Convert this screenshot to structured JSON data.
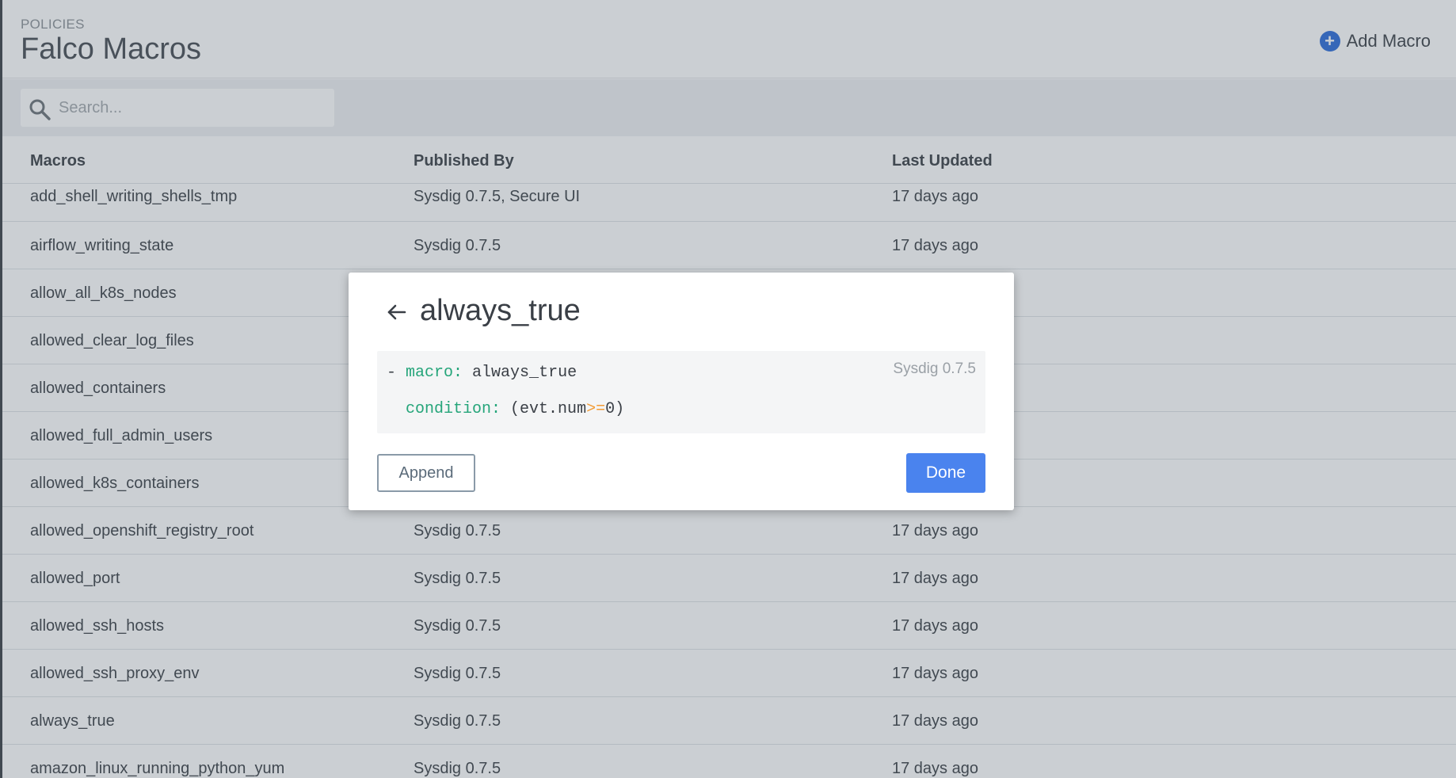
{
  "header": {
    "eyebrow": "POLICIES",
    "title": "Falco Macros",
    "add_label": "Add Macro"
  },
  "search": {
    "placeholder": "Search..."
  },
  "table": {
    "columns": [
      "Macros",
      "Published By",
      "Last Updated"
    ],
    "rows": [
      {
        "name": "add_shell_writing_shells_tmp",
        "published_by": "Sysdig 0.7.5, Secure UI",
        "updated": "17 days ago"
      },
      {
        "name": "airflow_writing_state",
        "published_by": "Sysdig 0.7.5",
        "updated": "17 days ago"
      },
      {
        "name": "allow_all_k8s_nodes",
        "published_by": "",
        "updated": ""
      },
      {
        "name": "allowed_clear_log_files",
        "published_by": "",
        "updated": ""
      },
      {
        "name": "allowed_containers",
        "published_by": "",
        "updated": ""
      },
      {
        "name": "allowed_full_admin_users",
        "published_by": "",
        "updated": ""
      },
      {
        "name": "allowed_k8s_containers",
        "published_by": "",
        "updated": ""
      },
      {
        "name": "allowed_openshift_registry_root",
        "published_by": "Sysdig 0.7.5",
        "updated": "17 days ago"
      },
      {
        "name": "allowed_port",
        "published_by": "Sysdig 0.7.5",
        "updated": "17 days ago"
      },
      {
        "name": "allowed_ssh_hosts",
        "published_by": "Sysdig 0.7.5",
        "updated": "17 days ago"
      },
      {
        "name": "allowed_ssh_proxy_env",
        "published_by": "Sysdig 0.7.5",
        "updated": "17 days ago"
      },
      {
        "name": "always_true",
        "published_by": "Sysdig 0.7.5",
        "updated": "17 days ago"
      },
      {
        "name": "amazon_linux_running_python_yum",
        "published_by": "Sysdig 0.7.5",
        "updated": "17 days ago"
      }
    ]
  },
  "modal": {
    "title": "always_true",
    "publisher": "Sysdig 0.7.5",
    "code": {
      "dash": "-",
      "macro_key": "macro:",
      "macro_value": " always_true",
      "condition_key": "condition:",
      "cond_open": " (evt.num",
      "cond_op": ">=",
      "cond_close": "0)"
    },
    "append_label": "Append",
    "done_label": "Done"
  },
  "icons": {
    "back": "arrow-left-icon",
    "search": "search-icon",
    "add": "plus-circle-icon"
  },
  "colors": {
    "accent": "#4a83ee",
    "yaml_key": "#25a57a",
    "yaml_operator": "#f39c35"
  }
}
